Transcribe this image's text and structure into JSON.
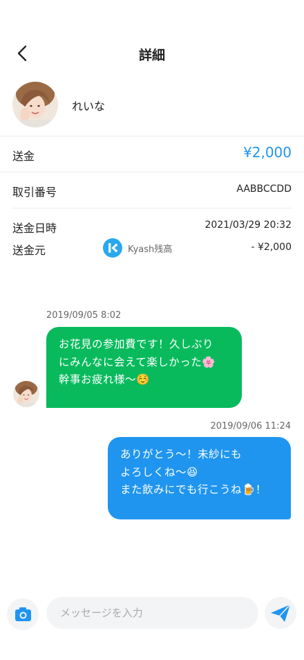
{
  "header": {
    "title": "詳細"
  },
  "profile": {
    "name": "れいな"
  },
  "transfer": {
    "type_label": "送金",
    "amount": "¥2,000",
    "txn_label": "取引番号",
    "txn_id": "AABBCCDD",
    "datetime_label": "送金日時",
    "datetime": "2021/03/29 20:32",
    "source_label": "送金元",
    "source_name": "Kyash残高",
    "source_amount": "- ¥2,000"
  },
  "messages": [
    {
      "timestamp": "2019/09/05 8:02",
      "lines": [
        "お花見の参加費です！久しぶり",
        "にみんなに会えて楽しかった🌸",
        "幹事お疲れ様〜☺️"
      ],
      "direction": "incoming"
    },
    {
      "timestamp": "2019/09/06 11:24",
      "lines": [
        "ありがとう〜！未紗にも",
        "よろしくね〜😆",
        "また飲みにでも行こうね🍺！"
      ],
      "direction": "outgoing"
    }
  ],
  "composer": {
    "placeholder": "メッセージを入力",
    "camera_icon": "camera-icon",
    "send_icon": "send-icon"
  },
  "colors": {
    "accent": "#1f95f0",
    "incoming_bubble": "#09ba5d",
    "outgoing_bubble": "#1f95f0",
    "kyash_logo": "#2aa8ee"
  }
}
